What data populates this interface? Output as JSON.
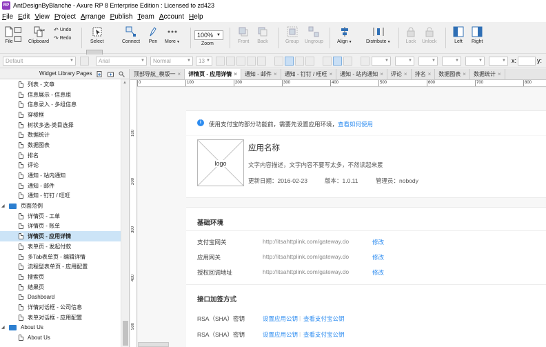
{
  "window": {
    "title": "AntDesignByBlanche - Axure RP 8 Enterprise Edition : Licensed to zd423",
    "app_icon_text": "RP"
  },
  "menu": [
    "File",
    "Edit",
    "View",
    "Project",
    "Arrange",
    "Publish",
    "Team",
    "Account",
    "Help"
  ],
  "toolbar": {
    "file": "File",
    "clipboard": "Clipboard",
    "undo": "Undo",
    "redo": "Redo",
    "select": "Select",
    "connect": "Connect",
    "pen": "Pen",
    "more": "More",
    "zoom_value": "100%",
    "zoom": "Zoom",
    "front": "Front",
    "back": "Back",
    "group": "Group",
    "ungroup": "Ungroup",
    "align": "Align",
    "distribute": "Distribute",
    "lock": "Lock",
    "unlock": "Unlock",
    "left": "Left",
    "right": "Right"
  },
  "formatbar": {
    "style": "Default",
    "font": "Arial",
    "weight": "Normal",
    "size": "13",
    "x_label": "x:",
    "y_label": "y:"
  },
  "left_panel": {
    "title": "Widget Library Pages",
    "items": [
      {
        "label": "列表 - 文章",
        "type": "page"
      },
      {
        "label": "信息展示 - 信息组",
        "type": "page"
      },
      {
        "label": "信息录入 - 多组信息",
        "type": "page"
      },
      {
        "label": "穿梭框",
        "type": "page"
      },
      {
        "label": "树状多选-类目选择",
        "type": "page"
      },
      {
        "label": "数据统计",
        "type": "page"
      },
      {
        "label": "数据图表",
        "type": "page"
      },
      {
        "label": "排名",
        "type": "page"
      },
      {
        "label": "评论",
        "type": "page"
      },
      {
        "label": "通知 - 站内通知",
        "type": "page"
      },
      {
        "label": "通知 - 邮件",
        "type": "page"
      },
      {
        "label": "通知 - 钉钉 / 旺旺",
        "type": "page"
      },
      {
        "label": "页面范例",
        "type": "folder"
      },
      {
        "label": "详情页 - 工单",
        "type": "page"
      },
      {
        "label": "详情页 - 账单",
        "type": "page"
      },
      {
        "label": "详情页 - 应用详情",
        "type": "page",
        "selected": true
      },
      {
        "label": "表单页 - 发起付款",
        "type": "page"
      },
      {
        "label": "多Tab表单页 - 编辑详情",
        "type": "page"
      },
      {
        "label": "流程型表单页 - 应用配置",
        "type": "page"
      },
      {
        "label": "搜索页",
        "type": "page"
      },
      {
        "label": "结果页",
        "type": "page"
      },
      {
        "label": "Dashboard",
        "type": "page"
      },
      {
        "label": "详情对话框 - 公司信息",
        "type": "page"
      },
      {
        "label": "表单对话框 - 应用配置",
        "type": "page"
      },
      {
        "label": "About Us",
        "type": "folder"
      },
      {
        "label": "About Us",
        "type": "page"
      }
    ]
  },
  "tabs": [
    {
      "label": "顶部导航_模版一",
      "active": false
    },
    {
      "label": "详情页 - 应用详情",
      "active": true
    },
    {
      "label": "通知 - 邮件",
      "active": false
    },
    {
      "label": "通知 - 钉钉 / 旺旺",
      "active": false
    },
    {
      "label": "通知 - 站内通知",
      "active": false
    },
    {
      "label": "评论",
      "active": false
    },
    {
      "label": "排名",
      "active": false
    },
    {
      "label": "数据图表",
      "active": false
    },
    {
      "label": "数据统计",
      "active": false
    }
  ],
  "ruler": {
    "h_ticks": [
      "0",
      "100",
      "200",
      "300",
      "400",
      "500",
      "600",
      "700",
      "800"
    ],
    "v_ticks": [
      "100",
      "200",
      "300",
      "400",
      "500"
    ]
  },
  "canvas": {
    "alert": {
      "text": "使用支付宝的部分功能前，需要先设置应用环境，",
      "link": "查看如何使用"
    },
    "app": {
      "logo": "logo",
      "name": "应用名称",
      "desc": "文字内容描述，文字内容不要写太多，不然读起来累",
      "updated": "更新日期：2016-02-23",
      "version": "版本：1.0.11",
      "admin": "管理员：nobody"
    },
    "env": {
      "title": "基础环境",
      "rows": [
        {
          "label": "支付宝网关",
          "value": "http://itsahttplink.com/gateway.do",
          "action": "修改"
        },
        {
          "label": "应用网关",
          "value": "http://itsahttplink.com/gateway.do",
          "action": "修改"
        },
        {
          "label": "授权回调地址",
          "value": "http://itsahttplink.com/gateway.do",
          "action": "修改"
        }
      ]
    },
    "sign": {
      "title": "接口加签方式",
      "rows": [
        {
          "label": "RSA（SHA）密钥",
          "action1": "设置应用公钥",
          "action2": "查看支付宝公钥"
        },
        {
          "label": "RSA（SHA）密钥",
          "action1": "设置应用公钥",
          "action2": "查看支付宝公钥"
        }
      ]
    }
  }
}
